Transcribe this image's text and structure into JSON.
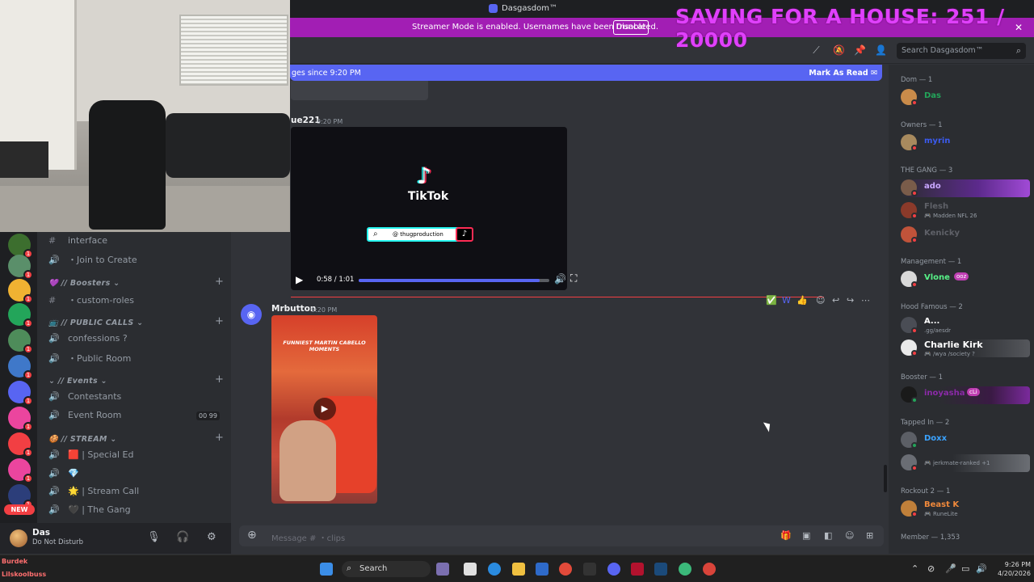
{
  "window": {
    "title": "Dasgasdom™"
  },
  "overlay": {
    "goal_text": "SAVING FOR A HOUSE: 251 / 20000",
    "bottom_left_1": "Burdek",
    "bottom_left_2": "Lilskoolbuss"
  },
  "streamer_banner": {
    "text": "Streamer Mode is enabled. Usernames have been truncated.",
    "disable_label": "Disable"
  },
  "topbar": {
    "search_placeholder": "Search Dasgasdom™"
  },
  "new_messages_bar": {
    "text": "ges since 9:20 PM",
    "mark_read": "Mark As Read"
  },
  "channels": {
    "items": [
      {
        "glyph": "#",
        "label": "interface"
      },
      {
        "glyph": "🔊",
        "label": "・Join to Create"
      },
      {
        "glyph": "#",
        "label": "・custom-roles"
      },
      {
        "glyph": "🔊",
        "label": "confessions ?"
      },
      {
        "glyph": "🔊",
        "label": "・Public Room"
      },
      {
        "glyph": "🔊",
        "label": "Contestants"
      },
      {
        "glyph": "🔊",
        "label": "Event Room"
      },
      {
        "glyph": "🔊",
        "label": "🟥 | Special Ed"
      },
      {
        "glyph": "🔊",
        "label": "💎"
      },
      {
        "glyph": "🔊",
        "label": "🌟 | Stream Call"
      },
      {
        "glyph": "🔊",
        "label": "🖤 | The Gang"
      }
    ],
    "categories": [
      {
        "label": "💜 // Boosters ⌄"
      },
      {
        "label": "📺 // PUBLIC CALLS ⌄"
      },
      {
        "label": "⌄ // Events ⌄"
      },
      {
        "label": "🍪 // STREAM ⌄"
      }
    ],
    "event_room_counts": "00 99"
  },
  "user_panel": {
    "name": "Das",
    "status": "Do Not Disturb"
  },
  "chat": {
    "msg1_author": "ue221",
    "msg1_time": "9:20 PM",
    "tiktok": {
      "logo_text": "TikTok",
      "handle": "@ thugproduction",
      "time": "0:58 / 1:01",
      "progress": 0.95
    },
    "msg2_author": "Mrbutton",
    "msg2_time": "9:20 PM",
    "video_caption": "FUNNIEST MARTIN CABELLO MOMENTS",
    "composer_placeholder": "Message # ・clips"
  },
  "members": {
    "groups": [
      {
        "header": "Dom — 1",
        "rows": [
          {
            "name": "Das",
            "color": "#23a55a",
            "activity": ""
          }
        ]
      },
      {
        "header": "Owners — 1",
        "rows": [
          {
            "name": "myrin",
            "color": "#3b5bf0",
            "activity": ""
          }
        ]
      },
      {
        "header": "THE GANG — 3",
        "rows": [
          {
            "name": "ado",
            "color": "#c9a7ff",
            "activity": ""
          },
          {
            "name": "Flesh",
            "color": "#5f6168",
            "activity": "🎮 Madden NFL 26"
          },
          {
            "name": "Kenicky",
            "color": "#5f6168",
            "activity": ""
          }
        ]
      },
      {
        "header": "Management — 1",
        "rows": [
          {
            "name": "Vlone",
            "color": "#57f287",
            "activity": "",
            "pill": "ooz"
          }
        ]
      },
      {
        "header": "Hood Famous — 2",
        "rows": [
          {
            "name": "A...",
            "color": "#ffffff",
            "activity": ".gg/aesdr"
          },
          {
            "name": "Charlie Kirk",
            "color": "#ffffff",
            "activity": "🎮 /wya /society ?"
          }
        ]
      },
      {
        "header": "Booster — 1",
        "rows": [
          {
            "name": "inoyasha",
            "color": "#8b2aa8",
            "activity": "",
            "pill": "cLi"
          }
        ]
      },
      {
        "header": "Tapped In — 2",
        "rows": [
          {
            "name": "Doxx",
            "color": "#3ba3ff",
            "activity": ""
          },
          {
            "name": "",
            "color": "#5f6168",
            "activity": "🎮 jerkmate-ranked +1"
          }
        ]
      },
      {
        "header": "Rockout 2 — 1",
        "rows": [
          {
            "name": "Beast K",
            "color": "#f0893b",
            "activity": "🎮 RuneLite"
          }
        ]
      },
      {
        "header": "Member — 1,353",
        "rows": []
      }
    ]
  },
  "taskbar": {
    "search_label": "Search",
    "time": "9:26 PM",
    "date": "4/20/2026"
  }
}
